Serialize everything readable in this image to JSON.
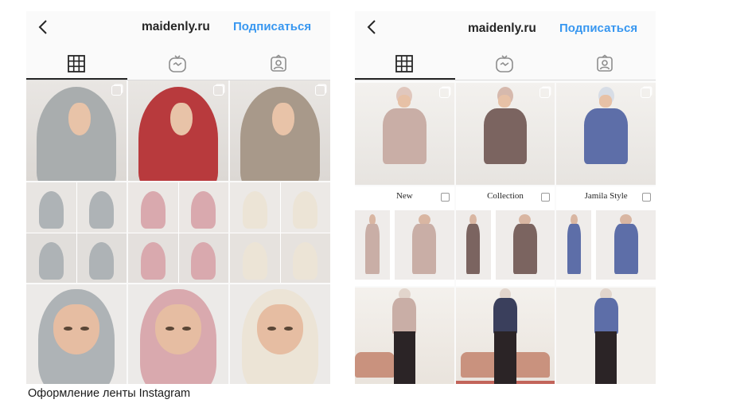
{
  "left_screen": {
    "header": {
      "username": "maidenly.ru",
      "follow_label": "Подписаться"
    },
    "tabs": [
      "grid-icon",
      "igtv-icon",
      "tagged-icon"
    ]
  },
  "right_screen": {
    "header": {
      "username": "maidenly.ru",
      "follow_label": "Подписаться"
    },
    "tabs": [
      "grid-icon",
      "igtv-icon",
      "tagged-icon"
    ],
    "story_titles": [
      "New",
      "Collection",
      "Jamila Style"
    ]
  },
  "caption": "Оформление ленты Instagram",
  "colors": {
    "link": "#3897f0",
    "scarf_grey": "#a9adae",
    "scarf_red": "#b83a3d",
    "scarf_taupe": "#a8998a",
    "knit_grey": "#aeb3b6",
    "knit_pink": "#d9a9ae",
    "knit_cream": "#ece4d6",
    "sweater_pink": "#c9aea6",
    "sweater_mauve": "#7b6460",
    "sweater_blue": "#5d6ea8"
  }
}
